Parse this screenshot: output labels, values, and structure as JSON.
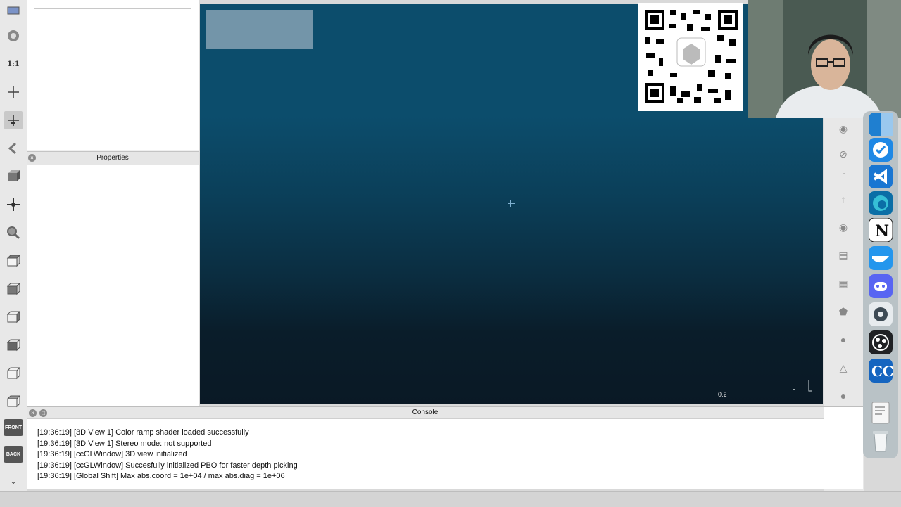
{
  "left_toolbar": {
    "icons": [
      {
        "name": "app-menu-icon"
      },
      {
        "name": "colorize-icon"
      },
      {
        "name": "zoom-1to1-label",
        "text": "1:1"
      },
      {
        "name": "add-point-icon"
      },
      {
        "name": "pick-center-icon"
      },
      {
        "name": "back-arrow-icon"
      },
      {
        "name": "cube-perspective-icon"
      },
      {
        "name": "move-cross-icon"
      },
      {
        "name": "zoom-icon"
      },
      {
        "name": "view-top-icon"
      },
      {
        "name": "view-left-icon"
      },
      {
        "name": "view-right-icon"
      },
      {
        "name": "view-bottom-icon"
      },
      {
        "name": "view-iso1-icon"
      },
      {
        "name": "view-iso2-icon"
      }
    ],
    "front_label": "FRONT",
    "back_label": "BACK"
  },
  "properties_panel": {
    "title": "Properties"
  },
  "view3d": {
    "scale_label": "0.2",
    "axis_label": "Y"
  },
  "console": {
    "title": "Console",
    "lines": [
      "[19:36:19] [3D View 1] Color ramp shader loaded successfully",
      "[19:36:19] [3D View 1] Stereo mode: not supported",
      "[19:36:19] [ccGLWindow] 3D view initialized",
      "[19:36:19] [ccGLWindow] Succesfully initialized PBO for faster depth picking",
      "[19:36:19] [Global Shift] Max abs.coord = 1e+04 / max abs.diag = 1e+06"
    ]
  },
  "dock": {
    "apps": [
      {
        "name": "finder-app",
        "color": "#1f7fd0"
      },
      {
        "name": "tasks-app",
        "color": "#1e88e5"
      },
      {
        "name": "vscode-app",
        "color": "#1976d2"
      },
      {
        "name": "edge-app",
        "color": "#0b6ea6"
      },
      {
        "name": "notion-app",
        "color": "#ffffff"
      },
      {
        "name": "docker-app",
        "color": "#2496ed"
      },
      {
        "name": "discord-app",
        "color": "#5865f2"
      },
      {
        "name": "screenshot-app",
        "color": "#3d4a54"
      },
      {
        "name": "obs-app",
        "color": "#202124"
      },
      {
        "name": "cloudcompare-app",
        "color": "#1565c0"
      },
      {
        "name": "document-app",
        "color": "#f2f2f2"
      },
      {
        "name": "trash-app",
        "color": "#dfe4e6"
      }
    ]
  },
  "colors": {
    "view_top": "#0c4d6c",
    "view_bottom": "#0a1925"
  }
}
